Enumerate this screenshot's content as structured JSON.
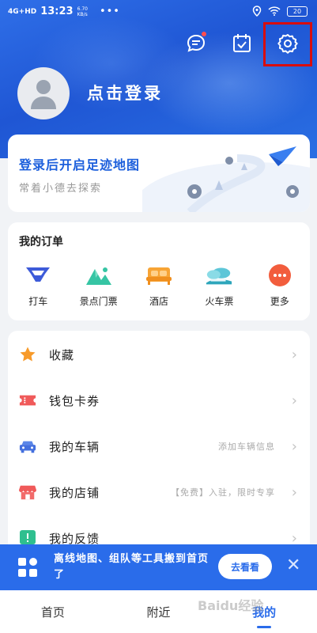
{
  "status_bar": {
    "signal": "4G+HD",
    "time": "13:23",
    "speed_value": "6.70",
    "speed_unit": "KB/s",
    "dots": "•••",
    "battery": "20"
  },
  "header": {
    "login_text": "点击登录"
  },
  "footmap_card": {
    "title": "登录后开启足迹地图",
    "subtitle": "常着小德去探索"
  },
  "orders": {
    "title": "我的订单",
    "items": [
      {
        "label": "打车",
        "icon": "taxi-icon"
      },
      {
        "label": "景点门票",
        "icon": "scenic-ticket-icon"
      },
      {
        "label": "酒店",
        "icon": "hotel-icon"
      },
      {
        "label": "火车票",
        "icon": "train-ticket-icon"
      },
      {
        "label": "更多",
        "icon": "more-icon"
      }
    ]
  },
  "menu": {
    "items": [
      {
        "label": "收藏",
        "hint": "",
        "icon": "star-icon"
      },
      {
        "label": "钱包卡券",
        "hint": "",
        "icon": "wallet-icon"
      },
      {
        "label": "我的车辆",
        "hint": "添加车辆信息",
        "icon": "car-icon"
      },
      {
        "label": "我的店铺",
        "hint": "【免费】入驻，限时专享",
        "icon": "shop-icon"
      },
      {
        "label": "我的反馈",
        "hint": "",
        "icon": "feedback-icon"
      }
    ]
  },
  "banner": {
    "text": "离线地图、组队等工具搬到首页了",
    "button": "去看看",
    "close": "✕"
  },
  "tabbar": {
    "tabs": [
      "首页",
      "附近",
      "我的"
    ],
    "active": 2
  },
  "watermark": "Baidu经验",
  "colors": {
    "brand_blue": "#2a6cea",
    "highlight_red": "#d80d0d"
  }
}
